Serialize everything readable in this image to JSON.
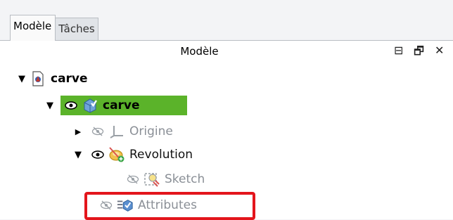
{
  "tabs": [
    {
      "label": "Modèle",
      "active": true
    },
    {
      "label": "Tâches",
      "active": false
    }
  ],
  "panel": {
    "title": "Modèle",
    "controls": {
      "restore_icon": "⊟",
      "float_icon": "🗗",
      "close_icon": "✕"
    }
  },
  "tree": {
    "document": {
      "label": "carve"
    },
    "body": {
      "label": "carve",
      "highlight": "#5bb32a"
    },
    "origin": {
      "label": "Origine"
    },
    "revolution": {
      "label": "Revolution"
    },
    "sketch": {
      "label": "Sketch"
    },
    "attributes": {
      "label": "Attributes"
    }
  },
  "colors": {
    "highlight": "#5bb32a",
    "annotation": "#e3151c",
    "gray_text": "#8a8f96"
  }
}
